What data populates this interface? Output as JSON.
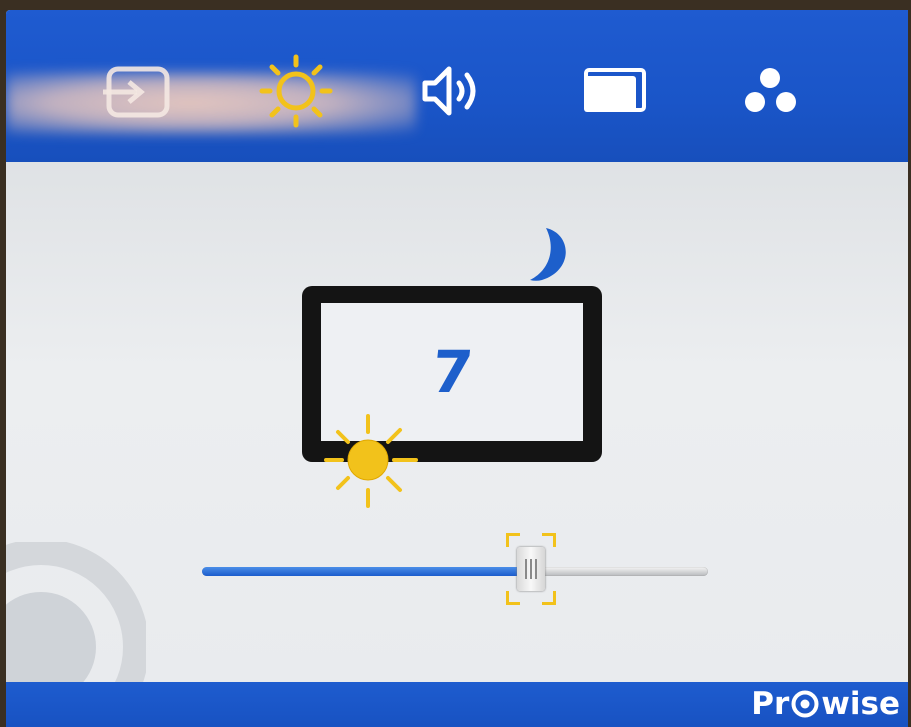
{
  "menu": {
    "tabs": [
      {
        "name": "source",
        "icon": "input-source-icon",
        "selected": false
      },
      {
        "name": "brightness",
        "icon": "sun-icon",
        "selected": true
      },
      {
        "name": "sound",
        "icon": "speaker-icon",
        "selected": false
      },
      {
        "name": "display",
        "icon": "screen-icon",
        "selected": false
      },
      {
        "name": "more",
        "icon": "three-dots-icon",
        "selected": false
      }
    ]
  },
  "brightness": {
    "value": "7",
    "slider_level": 0.65
  },
  "brand": {
    "name_prefix": "Pr",
    "name_suffix": "wise"
  },
  "colors": {
    "accent_blue": "#1f5bd0",
    "highlight_yellow": "#f2c21b",
    "value_blue": "#1d5fcb",
    "background": "#e8eaed"
  }
}
